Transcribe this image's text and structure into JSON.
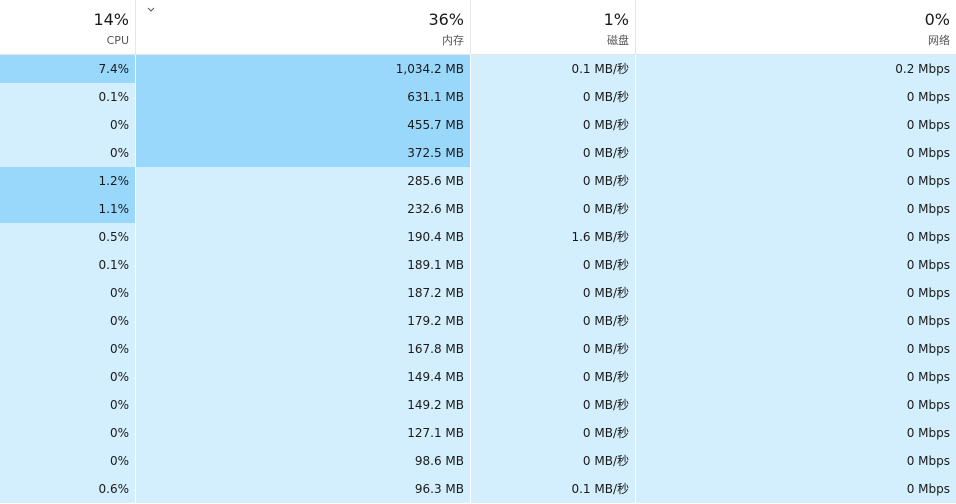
{
  "header": {
    "cpu": {
      "pct": "14%",
      "label": "CPU"
    },
    "memory": {
      "pct": "36%",
      "label": "内存"
    },
    "disk": {
      "pct": "1%",
      "label": "磁盘"
    },
    "network": {
      "pct": "0%",
      "label": "网络"
    }
  },
  "rows": [
    {
      "cpu": "7.4%",
      "mem": "1,034.2 MB",
      "disk": "0.1 MB/秒",
      "net": "0.2 Mbps",
      "hot": [
        "cpu",
        "mem"
      ]
    },
    {
      "cpu": "0.1%",
      "mem": "631.1 MB",
      "disk": "0 MB/秒",
      "net": "0 Mbps",
      "hot": [
        "mem"
      ]
    },
    {
      "cpu": "0%",
      "mem": "455.7 MB",
      "disk": "0 MB/秒",
      "net": "0 Mbps",
      "hot": [
        "mem"
      ]
    },
    {
      "cpu": "0%",
      "mem": "372.5 MB",
      "disk": "0 MB/秒",
      "net": "0 Mbps",
      "hot": [
        "mem"
      ]
    },
    {
      "cpu": "1.2%",
      "mem": "285.6 MB",
      "disk": "0 MB/秒",
      "net": "0 Mbps",
      "hot": [
        "cpu"
      ]
    },
    {
      "cpu": "1.1%",
      "mem": "232.6 MB",
      "disk": "0 MB/秒",
      "net": "0 Mbps",
      "hot": [
        "cpu"
      ]
    },
    {
      "cpu": "0.5%",
      "mem": "190.4 MB",
      "disk": "1.6 MB/秒",
      "net": "0 Mbps",
      "hot": []
    },
    {
      "cpu": "0.1%",
      "mem": "189.1 MB",
      "disk": "0 MB/秒",
      "net": "0 Mbps",
      "hot": []
    },
    {
      "cpu": "0%",
      "mem": "187.2 MB",
      "disk": "0 MB/秒",
      "net": "0 Mbps",
      "hot": []
    },
    {
      "cpu": "0%",
      "mem": "179.2 MB",
      "disk": "0 MB/秒",
      "net": "0 Mbps",
      "hot": []
    },
    {
      "cpu": "0%",
      "mem": "167.8 MB",
      "disk": "0 MB/秒",
      "net": "0 Mbps",
      "hot": []
    },
    {
      "cpu": "0%",
      "mem": "149.4 MB",
      "disk": "0 MB/秒",
      "net": "0 Mbps",
      "hot": []
    },
    {
      "cpu": "0%",
      "mem": "149.2 MB",
      "disk": "0 MB/秒",
      "net": "0 Mbps",
      "hot": []
    },
    {
      "cpu": "0%",
      "mem": "127.1 MB",
      "disk": "0 MB/秒",
      "net": "0 Mbps",
      "hot": []
    },
    {
      "cpu": "0%",
      "mem": "98.6 MB",
      "disk": "0 MB/秒",
      "net": "0 Mbps",
      "hot": []
    },
    {
      "cpu": "0.6%",
      "mem": "96.3 MB",
      "disk": "0.1 MB/秒",
      "net": "0 Mbps",
      "hot": []
    }
  ],
  "sort_indicator": {
    "icon": "chevron-down-icon",
    "column": "memory"
  }
}
